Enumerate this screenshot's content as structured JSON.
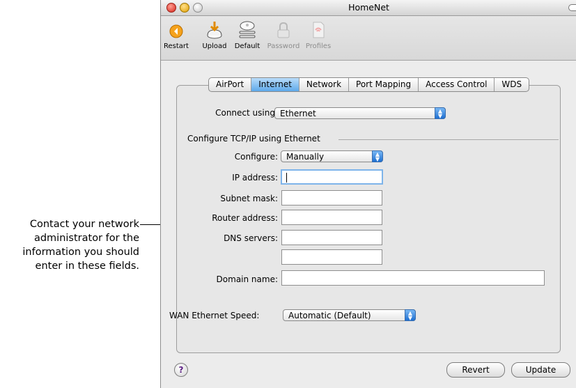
{
  "callout": {
    "lines": [
      "Contact your network",
      "administrator for the",
      "information you should",
      "enter in these fields."
    ]
  },
  "window": {
    "title": "HomeNet"
  },
  "toolbar": {
    "restart": "Restart",
    "upload": "Upload",
    "default": "Default",
    "password": "Password",
    "profiles": "Profiles"
  },
  "tabs": [
    "AirPort",
    "Internet",
    "Network",
    "Port Mapping",
    "Access Control",
    "WDS"
  ],
  "form": {
    "connect_using_label": "Connect using:",
    "connect_using_value": "Ethernet",
    "group_title": "Configure TCP/IP using Ethernet",
    "configure_label": "Configure:",
    "configure_value": "Manually",
    "ip_label": "IP address:",
    "ip_value": "",
    "subnet_label": "Subnet mask:",
    "subnet_value": "",
    "router_label": "Router address:",
    "router_value": "",
    "dns_label": "DNS servers:",
    "dns1_value": "",
    "dns2_value": "",
    "domain_label": "Domain name:",
    "domain_value": "",
    "wan_label": "WAN Ethernet Speed:",
    "wan_value": "Automatic (Default)"
  },
  "buttons": {
    "help": "?",
    "revert": "Revert",
    "update": "Update"
  },
  "colors": {
    "selected_tab": "#5ea9ea",
    "popup_arrows": "#1e6fd1",
    "restart_icon": "#f5a21c"
  }
}
